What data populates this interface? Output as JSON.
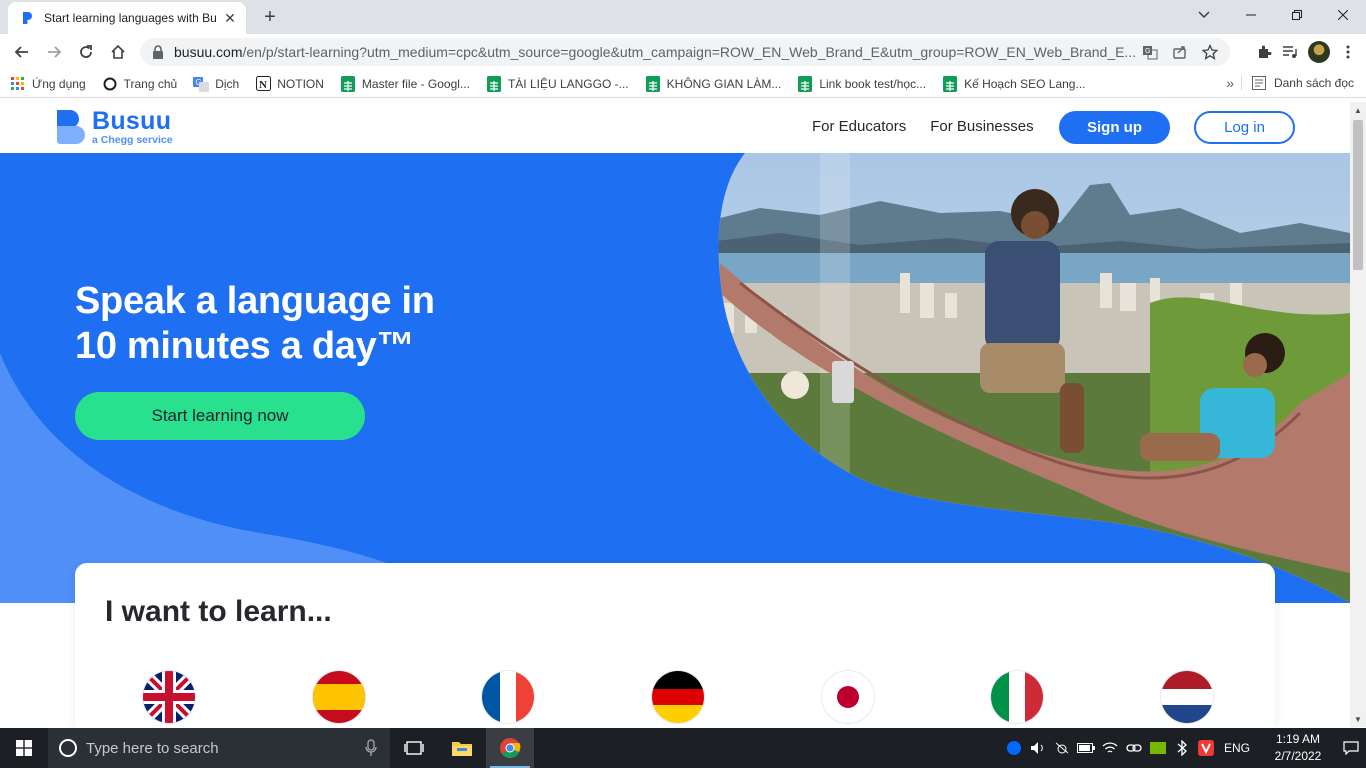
{
  "browser": {
    "tab_title": "Start learning languages with Busuu",
    "url_host": "busuu.com",
    "url_path": "/en/p/start-learning?utm_medium=cpc&utm_source=google&utm_campaign=ROW_EN_Web_Brand_E&utm_group=ROW_EN_Web_Brand_E...",
    "bookmarks": [
      {
        "label": "Ứng dụng",
        "icon": "apps-grid-icon"
      },
      {
        "label": "Trang chủ",
        "icon": "home-circle-icon"
      },
      {
        "label": "Dịch",
        "icon": "translate-icon"
      },
      {
        "label": "NOTION",
        "icon": "notion-icon"
      },
      {
        "label": "Master file - Googl...",
        "icon": "sheets-icon"
      },
      {
        "label": "TÀI LIỆU LANGGO -...",
        "icon": "sheets-icon"
      },
      {
        "label": "KHÔNG GIAN LÀM...",
        "icon": "sheets-icon"
      },
      {
        "label": "Link book test/học...",
        "icon": "sheets-icon"
      },
      {
        "label": "Kế Hoạch SEO Lang...",
        "icon": "sheets-icon"
      }
    ],
    "more_bookmarks": "»",
    "reading_list": "Danh sách đọc"
  },
  "site": {
    "brand": "Busuu",
    "brand_sub": "a Chegg service",
    "nav": {
      "educators": "For Educators",
      "businesses": "For Businesses",
      "signup": "Sign up",
      "login": "Log in"
    },
    "hero": {
      "title_line1": "Speak a language in",
      "title_line2": "10 minutes a day™",
      "cta": "Start learning now"
    },
    "learn": {
      "title": "I want to learn...",
      "flags": [
        "english-flag",
        "spanish-flag",
        "french-flag",
        "german-flag",
        "japanese-flag",
        "italian-flag",
        "dutch-flag"
      ]
    },
    "colors": {
      "brand_blue": "#1f6ff3",
      "cta_green": "#28e08e"
    }
  },
  "taskbar": {
    "search_placeholder": "Type here to search",
    "language": "ENG",
    "time": "1:19 AM",
    "date": "2/7/2022"
  }
}
